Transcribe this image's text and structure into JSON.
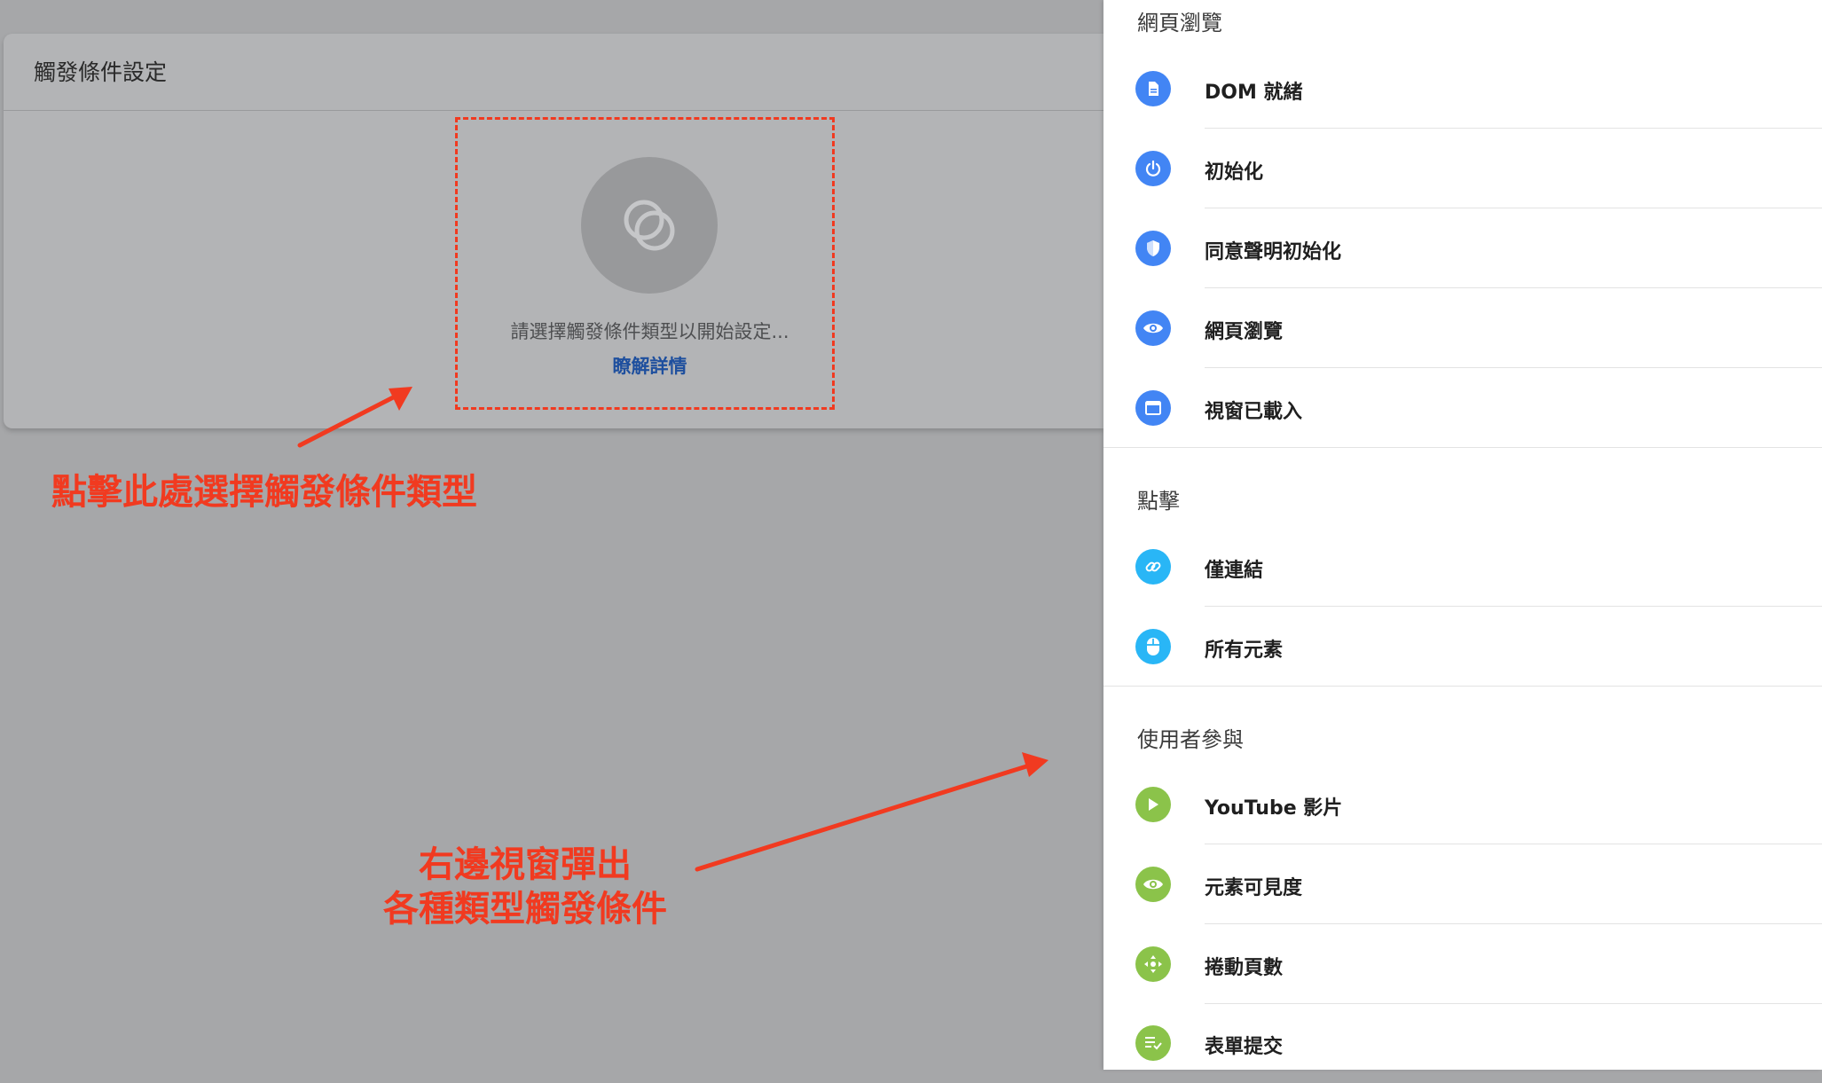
{
  "page": {
    "card_title": "觸發條件設定",
    "empty_text": "請選擇觸發條件類型以開始設定...",
    "learn_more": "瞭解詳情"
  },
  "annotations": {
    "left_note": "點擊此處選擇觸發條件類型",
    "bottom_note_line1": "右邊視窗彈出",
    "bottom_note_line2": "各種類型觸發條件"
  },
  "drawer": {
    "sections": [
      {
        "title": "網頁瀏覽",
        "items": [
          {
            "label": "DOM 就緒",
            "icon": "document-icon",
            "color": "#4285f4"
          },
          {
            "label": "初始化",
            "icon": "power-icon",
            "color": "#4285f4"
          },
          {
            "label": "同意聲明初始化",
            "icon": "shield-icon",
            "color": "#4285f4"
          },
          {
            "label": "網頁瀏覽",
            "icon": "eye-icon",
            "color": "#4285f4"
          },
          {
            "label": "視窗已載入",
            "icon": "window-icon",
            "color": "#4285f4"
          }
        ]
      },
      {
        "title": "點擊",
        "items": [
          {
            "label": "僅連結",
            "icon": "link-icon",
            "color": "#29b6f6"
          },
          {
            "label": "所有元素",
            "icon": "mouse-icon",
            "color": "#29b6f6"
          }
        ]
      },
      {
        "title": "使用者參與",
        "items": [
          {
            "label": "YouTube 影片",
            "icon": "play-icon",
            "color": "#8bc34a"
          },
          {
            "label": "元素可見度",
            "icon": "eye-icon",
            "color": "#8bc34a"
          },
          {
            "label": "捲動頁數",
            "icon": "move-icon",
            "color": "#8bc34a"
          },
          {
            "label": "表單提交",
            "icon": "form-icon",
            "color": "#8bc34a"
          }
        ]
      }
    ]
  }
}
